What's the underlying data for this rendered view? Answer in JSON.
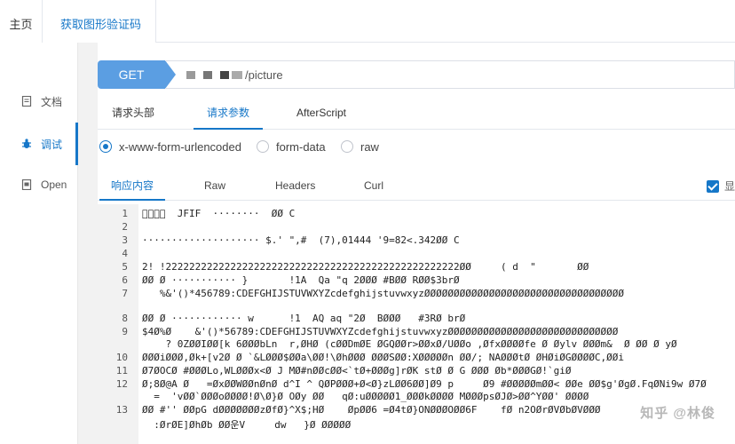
{
  "tabs": {
    "home": "主页",
    "active": "获取图形验证码",
    "close": "✕"
  },
  "sidebar": {
    "items": [
      {
        "label": "文档",
        "icon": "document-icon"
      },
      {
        "label": "调试",
        "icon": "bug-icon"
      },
      {
        "label": "Open",
        "icon": "open-doc-icon"
      }
    ]
  },
  "request": {
    "method": "GET",
    "url_suffix": "/picture"
  },
  "request_tabs": [
    "请求头部",
    "请求参数",
    "AfterScript"
  ],
  "body_types": [
    "x-www-form-urlencoded",
    "form-data",
    "raw"
  ],
  "response_tabs": [
    "响应内容",
    "Raw",
    "Headers",
    "Curl"
  ],
  "response_show_label": "显",
  "code_lines": [
    {
      "n": "1",
      "text": "\u0000\u0000\u0000\u0000  JFIF  ········  ØØ C"
    },
    {
      "n": "2",
      "text": ""
    },
    {
      "n": "3",
      "text": "···················· $.' \",#  (7),01444 '9=82<.342ØØ C"
    },
    {
      "n": "4",
      "text": ""
    },
    {
      "n": "5",
      "text": "2! !22222222222222222222222222222222222222222222222222ØØ     ( d  \"       ØØ"
    },
    {
      "n": "6",
      "text": "ØØ Ø ··········· }       !1A  Qa \"q 2ØØØ #BØØ RØØ$3brØ"
    },
    {
      "n": "7",
      "text": "   %&'()*456789:CDEFGHIJSTUVWXYZcdefghijstuvwxyzØØØØØØØØØØØØØØØØØØØØØØØØØØØØØØØØØØ"
    },
    {
      "n": "8",
      "text": "ØØ Ø ············ w      !1  AQ aq \"2Ø  BØØØ   #3RØ brØ"
    },
    {
      "n": "9",
      "text": "$4Ø%Ø    &'()*56789:CDEFGHIJSTUVWXYZcdefghijstuvwxyzØØØØØØØØØØØØØØØØØØØØØØØØØØØØØ"
    },
    {
      "n": "",
      "text": "    ? 0ZØØIØØ[k 6ØØØbLn  r,ØHØ (cØØDmØE ØGQØØr>ØØxØ/UØØo ,ØfxØØØØfe Ø Øylv ØØØm&  Ø ØØ Ø yØ"
    },
    {
      "n": "10",
      "text": "ØØØiØØØ,Øk+[v2Ø Ø `&LØØØ$ØØa\\ØØ!\\ØhØØØ ØØØSØØ:XØØØØØn ØØ/; NAØØØtØ ØHØiØGØØØØC,ØØi"
    },
    {
      "n": "11",
      "text": "Ø7ØOCØ #ØØØLo,WLØØØx<Ø J MØ#nØØcØØ<`tØ+ØØØg]rØK stØ Ø G ØØØ Øb*ØØØGØ!`giØ"
    },
    {
      "n": "12",
      "text": "Ø;8Ø@A Ø   =ØxØØWØØnØnØ d^I ^ QØPØØØ+Ø<Ø}zLØØ6ØØ]Ø9 p     Ø9 #ØØØØØmØØ< ØØe ØØ$g'ØgØ.FqØNi9w Ø7Ø"
    },
    {
      "n": "",
      "text": "  =  'vØØ`ØØØoØØØØ!Ø\\Ø}Ø OØy ØØ   qØ:uØØØØØ1_ØØØkØØØØ MØØØpsØJØ>ØØ^YØØ' ØØØØ"
    },
    {
      "n": "13",
      "text": "ØØ #'' ØØpG dØØØØØØØzØfØ}^X$;HØ    ØpØØ6 =Ø4tØ}ONØØØOØØ6F    fØ n2OØrØVØbØVØØØ"
    },
    {
      "n": "",
      "text": "  :ØrØE]ØhØb ØØ운V     dw   }Ø ØØØØØ"
    }
  ],
  "watermark": "知乎 @林俊"
}
